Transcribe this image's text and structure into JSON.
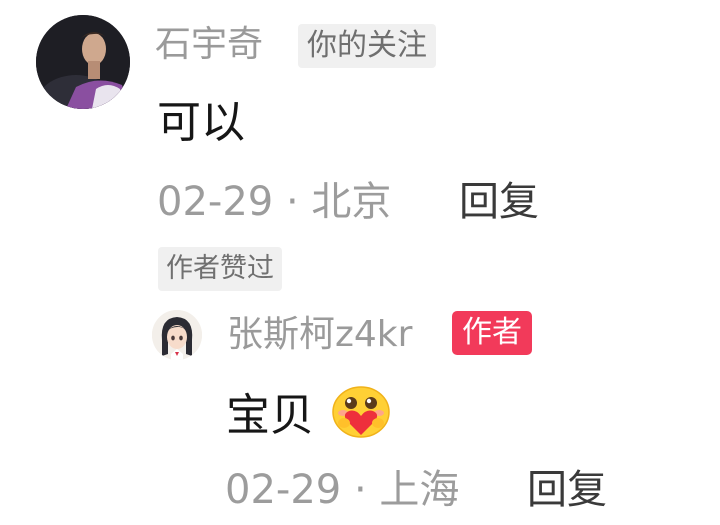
{
  "comment": {
    "user_name": "石宇奇",
    "follow_tag": "你的关注",
    "text": "可以",
    "date": "02-29",
    "separator": "·",
    "location": "北京",
    "reply_label": "回复",
    "liked_tag": "作者赞过"
  },
  "reply": {
    "user_name": "张斯柯z4kr",
    "author_tag": "作者",
    "text": "宝贝",
    "emoji": "smiling-face-with-heart-icon",
    "date": "02-29",
    "separator": "·",
    "location": "上海",
    "reply_label": "回复"
  },
  "colors": {
    "author_tag_bg": "#f23a5a",
    "meta_gray": "#9c9c9c",
    "tag_bg": "#f0f0f0"
  }
}
